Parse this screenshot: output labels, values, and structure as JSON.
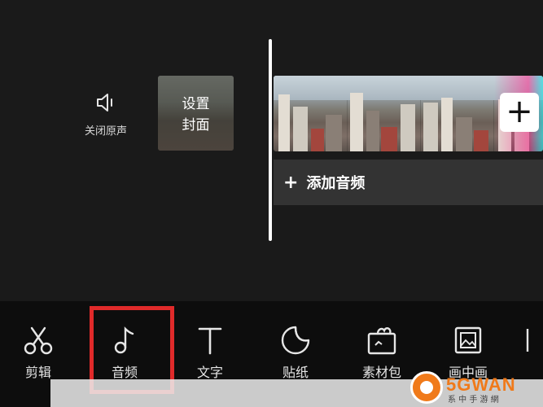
{
  "editor": {
    "mute": {
      "label": "关闭原声",
      "icon": "speaker-icon"
    },
    "cover": {
      "line1": "设置",
      "line2": "封面"
    },
    "add_clip": {
      "symbol": "+"
    },
    "add_audio": {
      "plus": "+",
      "label": "添加音频"
    }
  },
  "toolbar": {
    "items": [
      {
        "label": "剪辑",
        "icon": "scissors-icon"
      },
      {
        "label": "音频",
        "icon": "music-note-icon",
        "highlighted": true
      },
      {
        "label": "文字",
        "icon": "text-icon"
      },
      {
        "label": "贴纸",
        "icon": "sticker-icon"
      },
      {
        "label": "素材包",
        "icon": "material-pack-icon"
      },
      {
        "label": "画中画",
        "icon": "picture-in-picture-icon"
      }
    ],
    "highlight_color": "#e02a2a"
  },
  "watermark": {
    "brand": "5GWAN",
    "sub": "系 中 手 游 網",
    "color": "#f07a1a"
  }
}
